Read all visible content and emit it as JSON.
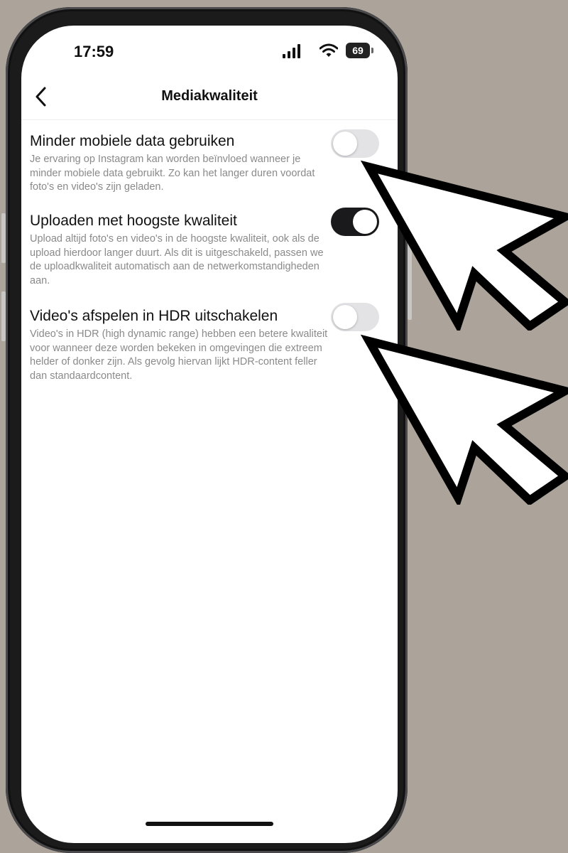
{
  "status": {
    "time": "17:59",
    "battery": "69",
    "icons": [
      "signal-icon",
      "wifi-icon",
      "battery-icon"
    ]
  },
  "nav": {
    "back_icon": "chevron-left-icon",
    "title": "Mediakwaliteit"
  },
  "settings": [
    {
      "title": "Minder mobiele data gebruiken",
      "description": "Je ervaring op Instagram kan worden beïnvloed wanneer je minder mobiele data gebruikt. Zo kan het langer duren voordat foto's en video's zijn geladen.",
      "enabled": false
    },
    {
      "title": "Uploaden met hoogste kwaliteit",
      "description": "Upload altijd foto's en video's in de hoogste kwaliteit, ook als de upload hierdoor langer duurt. Als dit is uitgeschakeld, passen we de uploadkwaliteit automatisch aan de netwerkomstandigheden aan.",
      "enabled": true
    },
    {
      "title": "Video's afspelen in HDR uitschakelen",
      "description": "Video's in HDR (high dynamic range) hebben een betere kwaliteit voor wanneer deze worden bekeken in omgevingen die extreem helder of donker zijn. Als gevolg hiervan lijkt HDR-content feller dan standaardcontent.",
      "enabled": false
    }
  ],
  "colors": {
    "background": "#aca49b",
    "toggle_on": "#1a1a1c",
    "toggle_off": "#e3e3e6",
    "description_text": "#8a8a8a"
  }
}
